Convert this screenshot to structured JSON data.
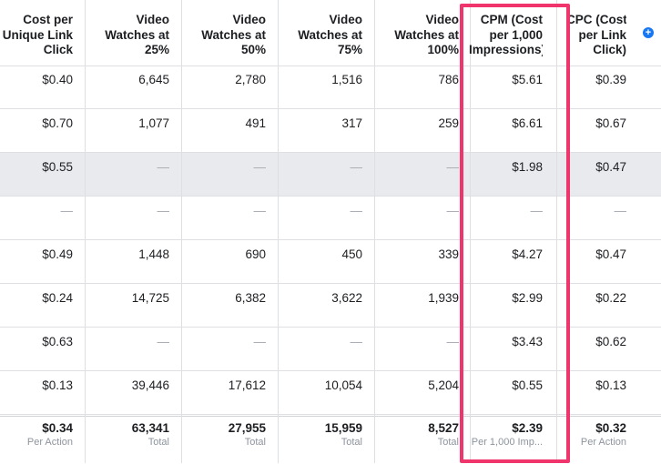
{
  "colors": {
    "highlight": "#f0356c",
    "row_highlight": "#e9eaed",
    "add_column": "#1877f2",
    "dash": "#a7abb1",
    "subtext": "#8d949e"
  },
  "add_column_icon": "plus-circle-icon",
  "add_column_symbol": "+",
  "columns": [
    {
      "key": "cpulc",
      "lines": [
        "Cost per",
        "Unique Link",
        "Click"
      ]
    },
    {
      "key": "vw25",
      "lines": [
        "Video",
        "Watches at",
        "25%"
      ]
    },
    {
      "key": "vw50",
      "lines": [
        "Video",
        "Watches at",
        "50%"
      ]
    },
    {
      "key": "vw75",
      "lines": [
        "Video",
        "Watches at",
        "75%"
      ]
    },
    {
      "key": "vw100",
      "lines": [
        "Video",
        "Watches at",
        "100%"
      ]
    },
    {
      "key": "cpm",
      "lines": [
        "CPM (Cost",
        "per 1,000",
        "Impressions)"
      ]
    },
    {
      "key": "cpc",
      "lines": [
        "CPC (Cost",
        "per Link",
        "Click)"
      ]
    }
  ],
  "rows": [
    {
      "cpulc": "$0.40",
      "vw25": "6,645",
      "vw50": "2,780",
      "vw75": "1,516",
      "vw100": "786",
      "cpm": "$5.61",
      "cpc": "$0.39"
    },
    {
      "cpulc": "$0.70",
      "vw25": "1,077",
      "vw50": "491",
      "vw75": "317",
      "vw100": "259",
      "cpm": "$6.61",
      "cpc": "$0.67"
    },
    {
      "cpulc": "$0.55",
      "vw25": "—",
      "vw50": "—",
      "vw75": "—",
      "vw100": "—",
      "cpm": "$1.98",
      "cpc": "$0.47"
    },
    {
      "cpulc": "—",
      "vw25": "—",
      "vw50": "—",
      "vw75": "—",
      "vw100": "—",
      "cpm": "—",
      "cpc": "—"
    },
    {
      "cpulc": "$0.49",
      "vw25": "1,448",
      "vw50": "690",
      "vw75": "450",
      "vw100": "339",
      "cpm": "$4.27",
      "cpc": "$0.47"
    },
    {
      "cpulc": "$0.24",
      "vw25": "14,725",
      "vw50": "6,382",
      "vw75": "3,622",
      "vw100": "1,939",
      "cpm": "$2.99",
      "cpc": "$0.22"
    },
    {
      "cpulc": "$0.63",
      "vw25": "—",
      "vw50": "—",
      "vw75": "—",
      "vw100": "—",
      "cpm": "$3.43",
      "cpc": "$0.62"
    },
    {
      "cpulc": "$0.13",
      "vw25": "39,446",
      "vw50": "17,612",
      "vw75": "10,054",
      "vw100": "5,204",
      "cpm": "$0.55",
      "cpc": "$0.13"
    }
  ],
  "totals": {
    "cpulc": {
      "value": "$0.34",
      "sub": "Per Action"
    },
    "vw25": {
      "value": "63,341",
      "sub": "Total"
    },
    "vw50": {
      "value": "27,955",
      "sub": "Total"
    },
    "vw75": {
      "value": "15,959",
      "sub": "Total"
    },
    "vw100": {
      "value": "8,527",
      "sub": "Total"
    },
    "cpm": {
      "value": "$2.39",
      "sub": "Per 1,000 Imp..."
    },
    "cpc": {
      "value": "$0.32",
      "sub": "Per Action"
    }
  }
}
